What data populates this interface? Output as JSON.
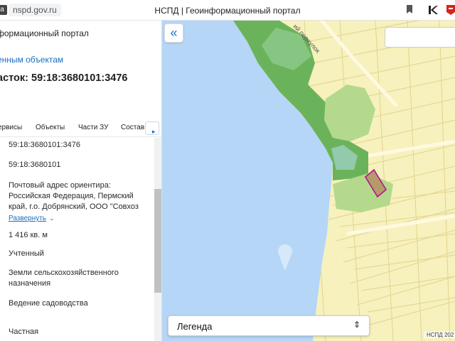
{
  "browser": {
    "tab_icon": "a",
    "url": "nspd.gov.ru",
    "page_title": "НСПД | Геоинформационный портал"
  },
  "panel": {
    "portal_title": "формационный портал",
    "breadcrumb_link": "енным объектам",
    "heading": "асток: 59:18:3680101:3476",
    "tabs": [
      "ервисы",
      "Объекты",
      "Части ЗУ",
      "Состав"
    ],
    "tab_next_icon": "chevron-right-icon",
    "rows": {
      "cadastral_number": "59:18:3680101:3476",
      "quarter": "59:18:3680101",
      "address_line1": "Почтовый адрес ориентира:",
      "address_line2": "Российская Федерация, Пермский",
      "address_line3": "край, г.о. Добрянский, ООО \"Совхоз",
      "expand_label": "Развернуть",
      "area": "1 416 кв. м",
      "status": "Учтенный",
      "category_line1": "Земли сельскохозяйственного",
      "category_line2": "назначения",
      "use": "Ведение садоводства",
      "ownership": "Частная"
    }
  },
  "map": {
    "street_label": "ий переулок",
    "legend_label": "Легенда",
    "attribution": "НСПД 202",
    "colors": {
      "water": "#b5d6f7",
      "land": "#f6f1bd",
      "forest": "#6bb35a",
      "light_green": "#b4d98c",
      "parcel_outline": "#b5158a"
    }
  }
}
